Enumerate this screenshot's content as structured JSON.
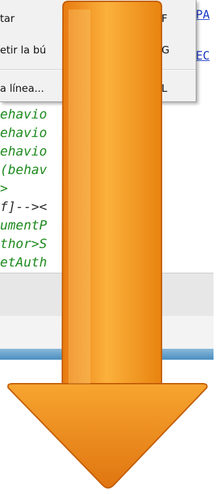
{
  "context_menu": {
    "items": [
      {
        "label": "tar",
        "shortcut": "F"
      },
      {
        "label": "etir la bú",
        "shortcut": "G"
      },
      {
        "label": "a línea...",
        "shortcut": "L"
      }
    ]
  },
  "editor": {
    "links": [
      "PA",
      "EC"
    ],
    "lines": [
      {
        "text": "ehavio   fault;",
        "color": "green"
      },
      {
        "text": "ehavio   fault;",
        "color": "green"
      },
      {
        "text": "ehavio   fault;",
        "color": "green"
      },
      {
        "text": "(behav   defau",
        "color": "green"
      },
      {
        "text": ">",
        "color": "green"
      },
      {
        "text": "f]--><   e mso",
        "color": "dark"
      },
      {
        "text": "umentP   >",
        "color": "green"
      },
      {
        "text": "thor>S   uthor",
        "color": "green"
      },
      {
        "text": "etAuth   Yo:La",
        "color": "green"
      }
    ]
  },
  "overlay": {
    "icon": "down-arrow-icon",
    "colors": {
      "fill_light": "#FBB13C",
      "fill_dark": "#E87A10",
      "outline": "#C35E06"
    }
  }
}
